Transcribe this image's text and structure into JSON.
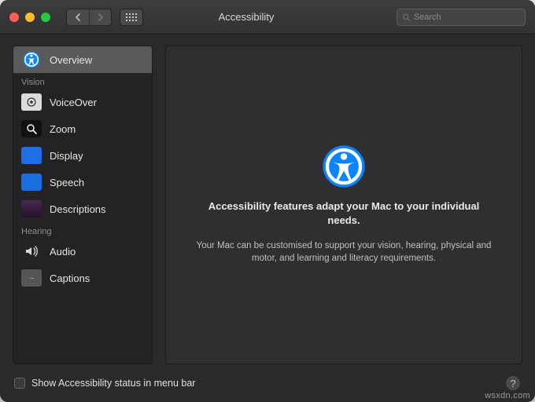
{
  "window": {
    "title": "Accessibility"
  },
  "search": {
    "placeholder": "Search",
    "value": ""
  },
  "sidebar": {
    "sections": [
      {
        "label": null,
        "items": [
          {
            "label": "Overview",
            "icon": "accessibility-icon",
            "selected": true
          }
        ]
      },
      {
        "label": "Vision",
        "items": [
          {
            "label": "VoiceOver",
            "icon": "voiceover-icon",
            "selected": false
          },
          {
            "label": "Zoom",
            "icon": "zoom-icon",
            "selected": false
          },
          {
            "label": "Display",
            "icon": "display-icon",
            "selected": false
          },
          {
            "label": "Speech",
            "icon": "speech-icon",
            "selected": false
          },
          {
            "label": "Descriptions",
            "icon": "descriptions-icon",
            "selected": false
          }
        ]
      },
      {
        "label": "Hearing",
        "items": [
          {
            "label": "Audio",
            "icon": "audio-icon",
            "selected": false
          },
          {
            "label": "Captions",
            "icon": "captions-icon",
            "selected": false
          }
        ]
      }
    ]
  },
  "content": {
    "heading": "Accessibility features adapt your Mac to your individual needs.",
    "subtext": "Your Mac can be customised to support your vision, hearing, physical and motor, and learning and literacy requirements."
  },
  "footer": {
    "checkbox_label": "Show Accessibility status in menu bar",
    "checkbox_checked": false
  },
  "watermark": "wsxdn.com",
  "colors": {
    "accent_blue": "#0a84ff",
    "window_bg": "#2a2a2c",
    "panel_bg": "#2f2f31"
  }
}
